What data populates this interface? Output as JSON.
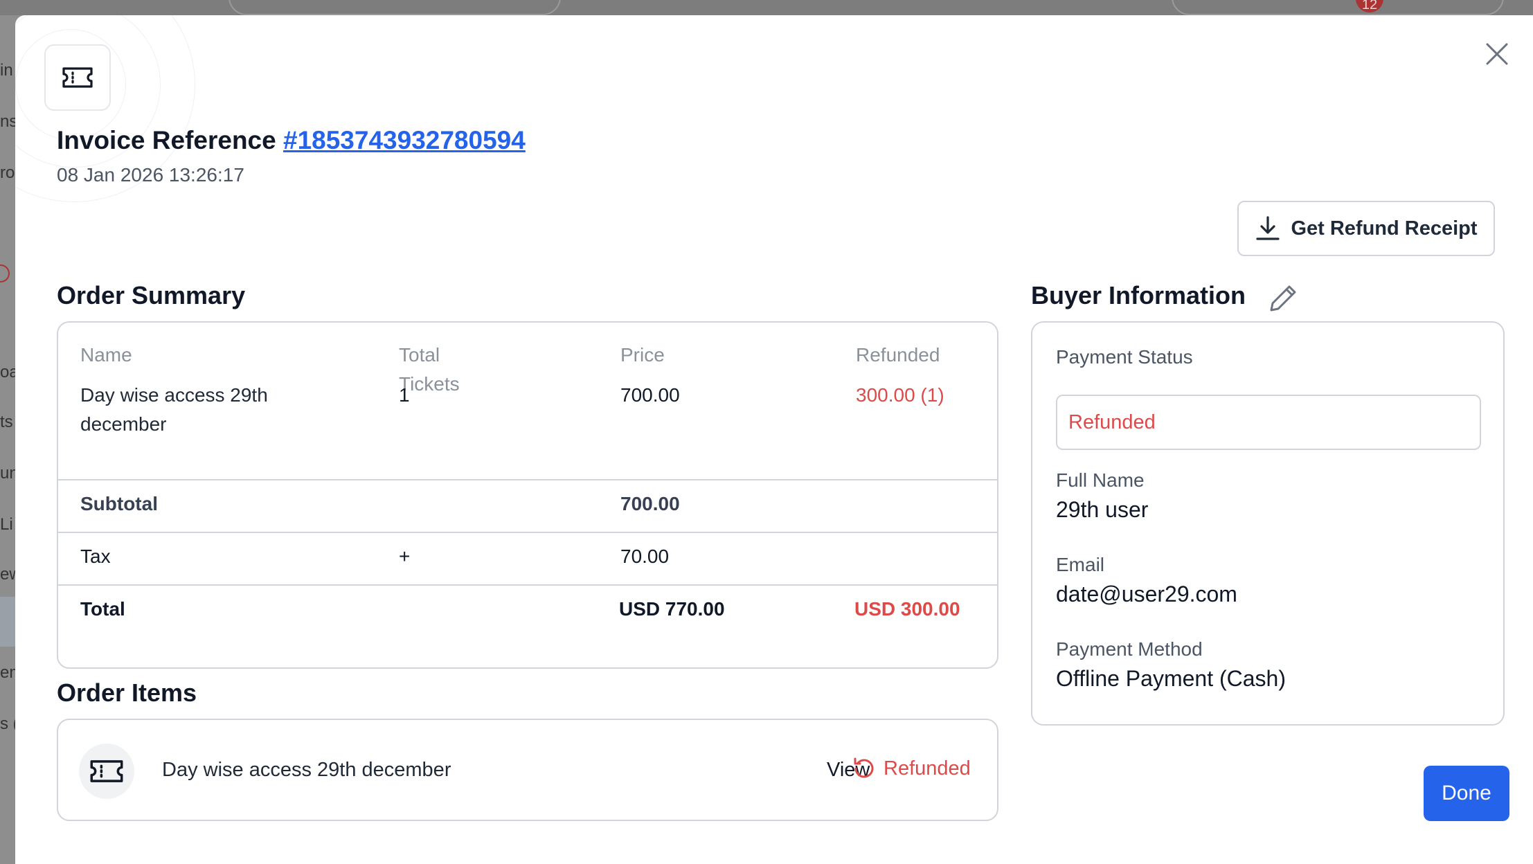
{
  "background": {
    "badge_count": "12",
    "sidebar_fragments": [
      "in",
      "ns",
      "ro",
      "oa",
      "ts",
      "un",
      "Li",
      "ew",
      "em",
      "s ("
    ]
  },
  "modal": {
    "title_prefix": "Invoice Reference",
    "invoice_number": "#1853743932780594",
    "date": "08 Jan 2026 13:26:17",
    "refund_receipt_label": "Get Refund Receipt",
    "done_label": "Done",
    "icons": {
      "header": "ticket-icon",
      "close": "close-icon",
      "download": "download-icon",
      "edit": "pencil-icon",
      "refund": "refund-icon"
    }
  },
  "order_summary": {
    "title": "Order Summary",
    "headers": {
      "name": "Name",
      "total_tickets_line1": "Total",
      "total_tickets_line2": "Tickets",
      "price": "Price",
      "refunded": "Refunded"
    },
    "row": {
      "name_line1": "Day wise access 29th",
      "name_line2": "december",
      "tickets": "1",
      "price": "700.00",
      "refunded": "300.00 (1)"
    },
    "subtotal": {
      "label": "Subtotal",
      "value": "700.00"
    },
    "tax": {
      "label": "Tax",
      "sign": "+",
      "value": "70.00"
    },
    "total": {
      "label": "Total",
      "value": "USD 770.00",
      "refunded": "USD 300.00"
    }
  },
  "order_items": {
    "title": "Order Items",
    "item": {
      "name": "Day wise access 29th december",
      "view_label": "View",
      "status": "Refunded"
    }
  },
  "buyer": {
    "title": "Buyer Information",
    "payment_status_label": "Payment Status",
    "payment_status_value": "Refunded",
    "full_name_label": "Full Name",
    "full_name_value": "29th user",
    "email_label": "Email",
    "email_value": "date@user29.com",
    "payment_method_label": "Payment Method",
    "payment_method_value": "Offline Payment (Cash)"
  },
  "colors": {
    "accent": "#2563eb",
    "refund_red": "#dc4a4a",
    "border": "#d1d5db"
  }
}
